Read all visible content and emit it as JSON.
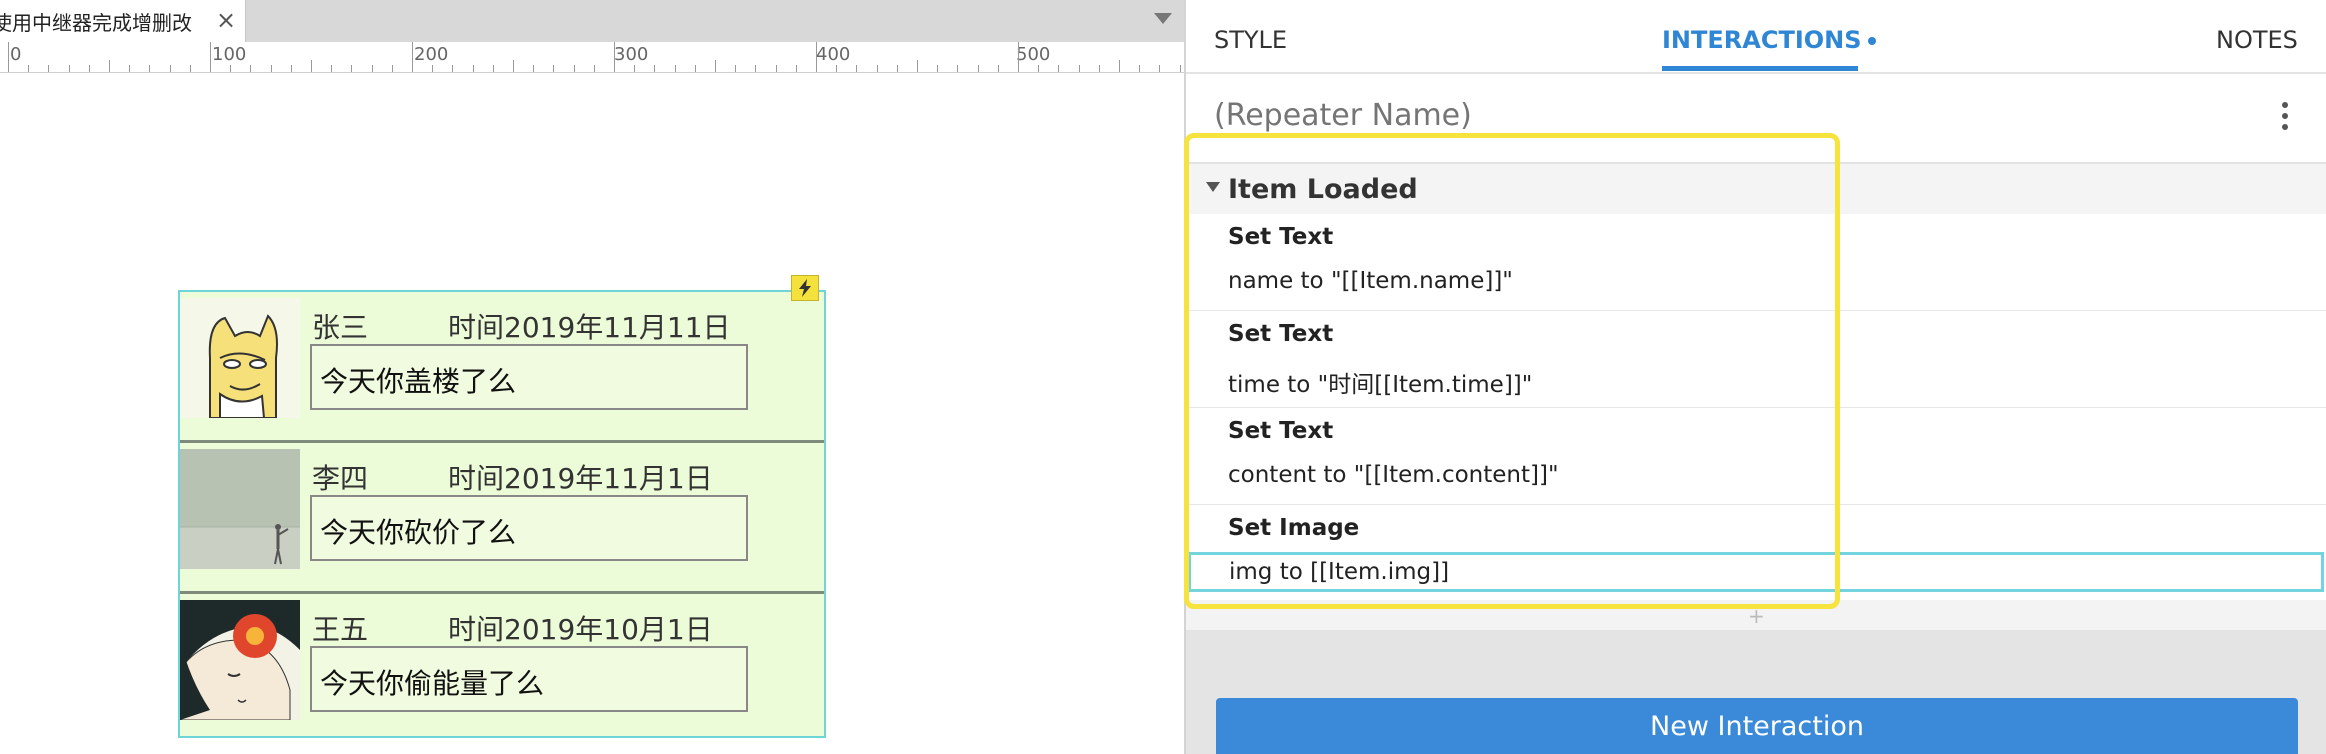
{
  "doc_tab": {
    "title": "使用中继器完成增删改",
    "close_glyph": "×"
  },
  "ruler": {
    "labels": [
      "0",
      "100",
      "200",
      "300",
      "400",
      "500"
    ]
  },
  "repeater": {
    "rows": [
      {
        "name": "张三",
        "time": "时间2019年11月11日",
        "content": "今天你盖楼了么",
        "img": "shiba-dog-image"
      },
      {
        "name": "李四",
        "time": "时间2019年11月1日",
        "content": "今天你砍价了么",
        "img": "person-by-sea-image"
      },
      {
        "name": "王五",
        "time": "时间2019年10月1日",
        "content": "今天你偷能量了么",
        "img": "girl-with-flower-image"
      }
    ],
    "bolt_icon": "lightning-icon"
  },
  "panel": {
    "tabs": {
      "style": "STYLE",
      "interactions": "INTERACTIONS",
      "notes": "NOTES"
    },
    "repeater_name_placeholder": "(Repeater Name)",
    "event": {
      "title": "Item Loaded",
      "actions": [
        {
          "title": "Set Text",
          "detail": "name to \"[[Item.name]]\""
        },
        {
          "title": "Set Text",
          "detail": "time to \"时间[[Item.time]]\""
        },
        {
          "title": "Set Text",
          "detail": "content to \"[[Item.content]]\""
        },
        {
          "title": "Set Image",
          "detail": "img to [[Item.img]]"
        }
      ],
      "add_glyph": "+"
    },
    "new_interaction_label": "New Interaction"
  },
  "colors": {
    "accent": "#2f86d4",
    "highlight": "#f6e33d",
    "selection": "#74d4dd",
    "repeater_bg": "#ecfbd8"
  }
}
